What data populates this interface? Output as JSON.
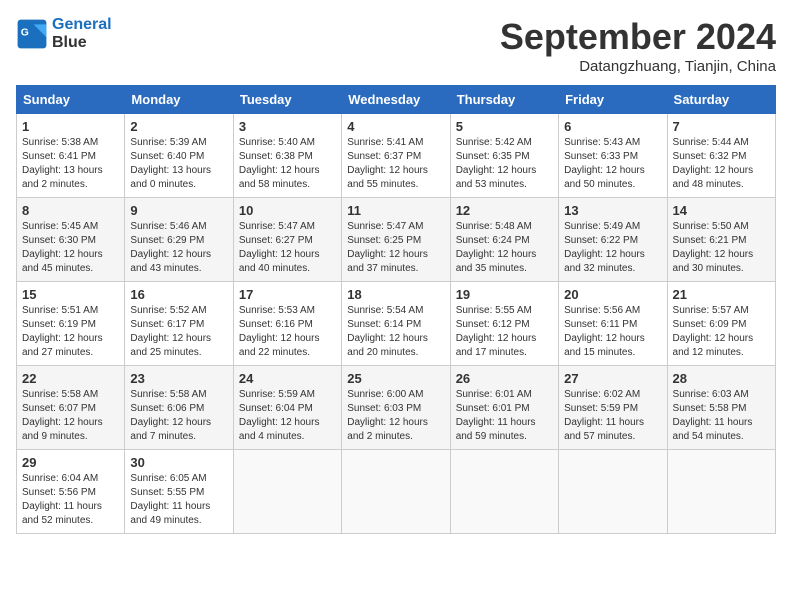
{
  "header": {
    "logo_line1": "General",
    "logo_line2": "Blue",
    "month": "September 2024",
    "location": "Datangzhuang, Tianjin, China"
  },
  "weekdays": [
    "Sunday",
    "Monday",
    "Tuesday",
    "Wednesday",
    "Thursday",
    "Friday",
    "Saturday"
  ],
  "weeks": [
    [
      {
        "day": "1",
        "info": "Sunrise: 5:38 AM\nSunset: 6:41 PM\nDaylight: 13 hours\nand 2 minutes."
      },
      {
        "day": "2",
        "info": "Sunrise: 5:39 AM\nSunset: 6:40 PM\nDaylight: 13 hours\nand 0 minutes."
      },
      {
        "day": "3",
        "info": "Sunrise: 5:40 AM\nSunset: 6:38 PM\nDaylight: 12 hours\nand 58 minutes."
      },
      {
        "day": "4",
        "info": "Sunrise: 5:41 AM\nSunset: 6:37 PM\nDaylight: 12 hours\nand 55 minutes."
      },
      {
        "day": "5",
        "info": "Sunrise: 5:42 AM\nSunset: 6:35 PM\nDaylight: 12 hours\nand 53 minutes."
      },
      {
        "day": "6",
        "info": "Sunrise: 5:43 AM\nSunset: 6:33 PM\nDaylight: 12 hours\nand 50 minutes."
      },
      {
        "day": "7",
        "info": "Sunrise: 5:44 AM\nSunset: 6:32 PM\nDaylight: 12 hours\nand 48 minutes."
      }
    ],
    [
      {
        "day": "8",
        "info": "Sunrise: 5:45 AM\nSunset: 6:30 PM\nDaylight: 12 hours\nand 45 minutes."
      },
      {
        "day": "9",
        "info": "Sunrise: 5:46 AM\nSunset: 6:29 PM\nDaylight: 12 hours\nand 43 minutes."
      },
      {
        "day": "10",
        "info": "Sunrise: 5:47 AM\nSunset: 6:27 PM\nDaylight: 12 hours\nand 40 minutes."
      },
      {
        "day": "11",
        "info": "Sunrise: 5:47 AM\nSunset: 6:25 PM\nDaylight: 12 hours\nand 37 minutes."
      },
      {
        "day": "12",
        "info": "Sunrise: 5:48 AM\nSunset: 6:24 PM\nDaylight: 12 hours\nand 35 minutes."
      },
      {
        "day": "13",
        "info": "Sunrise: 5:49 AM\nSunset: 6:22 PM\nDaylight: 12 hours\nand 32 minutes."
      },
      {
        "day": "14",
        "info": "Sunrise: 5:50 AM\nSunset: 6:21 PM\nDaylight: 12 hours\nand 30 minutes."
      }
    ],
    [
      {
        "day": "15",
        "info": "Sunrise: 5:51 AM\nSunset: 6:19 PM\nDaylight: 12 hours\nand 27 minutes."
      },
      {
        "day": "16",
        "info": "Sunrise: 5:52 AM\nSunset: 6:17 PM\nDaylight: 12 hours\nand 25 minutes."
      },
      {
        "day": "17",
        "info": "Sunrise: 5:53 AM\nSunset: 6:16 PM\nDaylight: 12 hours\nand 22 minutes."
      },
      {
        "day": "18",
        "info": "Sunrise: 5:54 AM\nSunset: 6:14 PM\nDaylight: 12 hours\nand 20 minutes."
      },
      {
        "day": "19",
        "info": "Sunrise: 5:55 AM\nSunset: 6:12 PM\nDaylight: 12 hours\nand 17 minutes."
      },
      {
        "day": "20",
        "info": "Sunrise: 5:56 AM\nSunset: 6:11 PM\nDaylight: 12 hours\nand 15 minutes."
      },
      {
        "day": "21",
        "info": "Sunrise: 5:57 AM\nSunset: 6:09 PM\nDaylight: 12 hours\nand 12 minutes."
      }
    ],
    [
      {
        "day": "22",
        "info": "Sunrise: 5:58 AM\nSunset: 6:07 PM\nDaylight: 12 hours\nand 9 minutes."
      },
      {
        "day": "23",
        "info": "Sunrise: 5:58 AM\nSunset: 6:06 PM\nDaylight: 12 hours\nand 7 minutes."
      },
      {
        "day": "24",
        "info": "Sunrise: 5:59 AM\nSunset: 6:04 PM\nDaylight: 12 hours\nand 4 minutes."
      },
      {
        "day": "25",
        "info": "Sunrise: 6:00 AM\nSunset: 6:03 PM\nDaylight: 12 hours\nand 2 minutes."
      },
      {
        "day": "26",
        "info": "Sunrise: 6:01 AM\nSunset: 6:01 PM\nDaylight: 11 hours\nand 59 minutes."
      },
      {
        "day": "27",
        "info": "Sunrise: 6:02 AM\nSunset: 5:59 PM\nDaylight: 11 hours\nand 57 minutes."
      },
      {
        "day": "28",
        "info": "Sunrise: 6:03 AM\nSunset: 5:58 PM\nDaylight: 11 hours\nand 54 minutes."
      }
    ],
    [
      {
        "day": "29",
        "info": "Sunrise: 6:04 AM\nSunset: 5:56 PM\nDaylight: 11 hours\nand 52 minutes."
      },
      {
        "day": "30",
        "info": "Sunrise: 6:05 AM\nSunset: 5:55 PM\nDaylight: 11 hours\nand 49 minutes."
      },
      {
        "day": "",
        "info": ""
      },
      {
        "day": "",
        "info": ""
      },
      {
        "day": "",
        "info": ""
      },
      {
        "day": "",
        "info": ""
      },
      {
        "day": "",
        "info": ""
      }
    ]
  ]
}
